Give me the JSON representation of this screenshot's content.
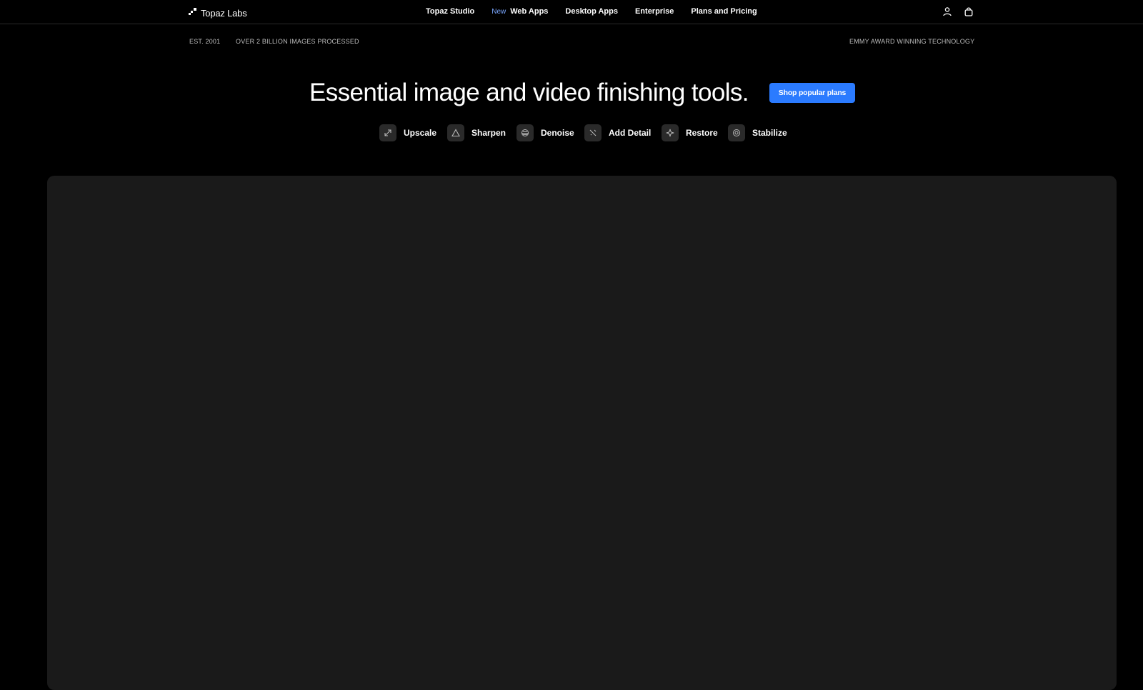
{
  "brand": {
    "name": "Topaz Labs",
    "logo_icon": "topaz-logo-icon"
  },
  "nav": {
    "links": [
      {
        "label": "Topaz Studio"
      },
      {
        "badge": "New",
        "label": "Web Apps"
      },
      {
        "label": "Desktop Apps"
      },
      {
        "label": "Enterprise"
      },
      {
        "label": "Plans and Pricing"
      }
    ],
    "icons": [
      "account-icon",
      "cart-icon"
    ]
  },
  "info": {
    "established": "EST. 2001",
    "processed": "OVER 2 BILLION IMAGES PROCESSED",
    "award": "EMMY AWARD WINNING TECHNOLOGY"
  },
  "hero": {
    "title": "Essential image and video finishing tools.",
    "cta_label": "Shop popular plans"
  },
  "tools": [
    {
      "label": "Upscale",
      "icon": "upscale-icon"
    },
    {
      "label": "Sharpen",
      "icon": "sharpen-icon"
    },
    {
      "label": "Denoise",
      "icon": "denoise-icon"
    },
    {
      "label": "Add Detail",
      "icon": "add-detail-icon"
    },
    {
      "label": "Restore",
      "icon": "restore-icon"
    },
    {
      "label": "Stabilize",
      "icon": "stabilize-icon"
    }
  ],
  "colors": {
    "background": "#000000",
    "accent": "#2b7bff",
    "panel": "#1a1a1a"
  }
}
